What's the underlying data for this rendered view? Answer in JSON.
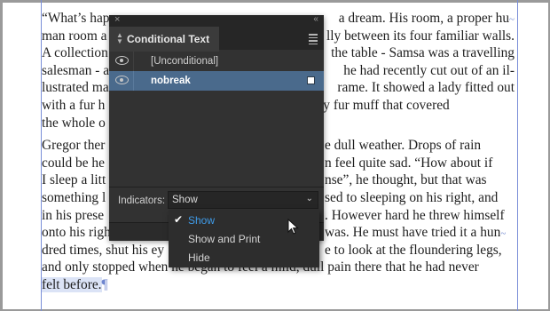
{
  "document": {
    "lines": [
      "“What’s hap",
      "man room a",
      "A collection",
      "salesman - a",
      "lustrated ma",
      "with a fur h",
      "the whole o",
      "Gregor ther",
      "could be he",
      "I sleep a litt",
      "something l",
      "in his prese",
      "onto his righ",
      "dred times, shut his ey",
      "and only stopped when he began to feel a mild, dull pain there that he had never",
      "felt before."
    ],
    "right_fragments": [
      "a dream. His room, a proper hu",
      "lly between its four familiar walls.",
      "the table - Samsa was a travelling",
      "he had recently cut out of an il-",
      "rame. It showed a lady fitted out",
      "g a heavy fur muff that covered",
      "",
      "e dull weather. Drops of rain",
      "n feel quite sad. “How about if",
      "nse”, he thought, but that was",
      "sed to sleeping on his right, and",
      ". However hard he threw himself",
      "was. He must have tried it a hun",
      "e to look at the floundering legs,"
    ],
    "pilcrow": "¶"
  },
  "panel": {
    "title": "Conditional Text",
    "close_glyph": "×",
    "collapse_glyph": "‹‹",
    "conditions": [
      {
        "label": "[Unconditional]",
        "visible": true,
        "selected": false
      },
      {
        "label": "nobreak",
        "visible": true,
        "selected": true
      }
    ],
    "indicators_label": "Indicators:",
    "indicators_value": "Show"
  },
  "dropdown": {
    "options": [
      {
        "label": "Show",
        "checked": true
      },
      {
        "label": "Show and Print",
        "checked": false
      },
      {
        "label": "Hide",
        "checked": false
      }
    ],
    "check_glyph": "✔"
  },
  "colors": {
    "panel_bg": "#323232",
    "selected_row": "#4a6a8c",
    "accent_text": "#3f9be8",
    "guide": "#7a8ed8"
  },
  "icons": [
    "eye-icon",
    "panel-menu-icon",
    "close-icon",
    "collapse-icon",
    "chevron-down-icon",
    "checkmark-icon",
    "mouse-pointer-icon",
    "tab-arrows-icon"
  ]
}
